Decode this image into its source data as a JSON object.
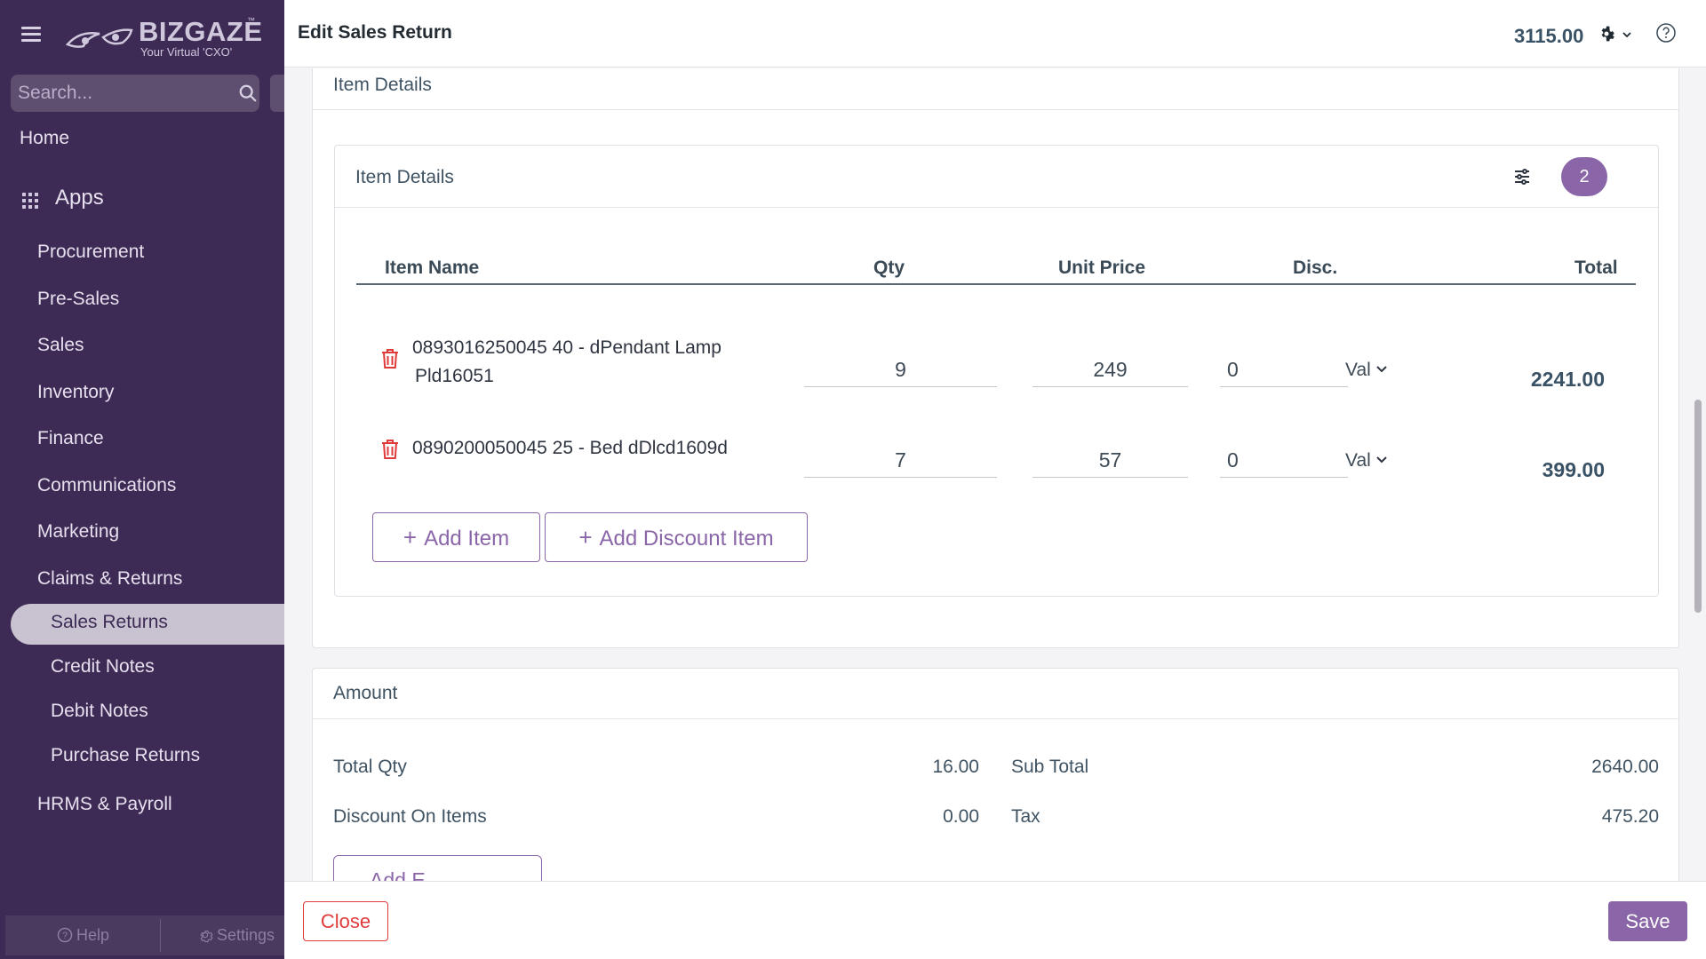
{
  "sidebar": {
    "logo": {
      "brand": "BIZGAZE",
      "tm": "™",
      "tagline": "Your Virtual 'CXO'"
    },
    "search": {
      "placeholder": "Search..."
    },
    "home": "Home",
    "apps": "Apps",
    "items": [
      "Procurement",
      "Pre-Sales",
      "Sales",
      "Inventory",
      "Finance",
      "Communications",
      "Marketing",
      "Claims & Returns"
    ],
    "subitems": [
      "Sales Returns",
      "Credit Notes",
      "Debit Notes",
      "Purchase Returns"
    ],
    "active_item": "Sales Returns",
    "last_item": "HRMS & Payroll",
    "footer": {
      "help": "Help",
      "settings": "Settings"
    }
  },
  "header": {
    "title": "Edit Sales Return",
    "total": "3115.00"
  },
  "item_details": {
    "section_title": "Item Details",
    "inner_title": "Item Details",
    "count": "2",
    "columns": {
      "name": "Item Name",
      "qty": "Qty",
      "unit_price": "Unit Price",
      "disc": "Disc.",
      "total": "Total"
    },
    "rows": [
      {
        "name_line1": "0893016250045 40 - dPendant Lamp",
        "name_line2": "Pld16051",
        "qty": "9",
        "unit_price": "249",
        "disc": "0",
        "disc_type": "Val",
        "total": "2241.00"
      },
      {
        "name_line1": "0890200050045 25 - Bed dDlcd1609d",
        "name_line2": "",
        "qty": "7",
        "unit_price": "57",
        "disc": "0",
        "disc_type": "Val",
        "total": "399.00"
      }
    ],
    "add_item": "Add Item",
    "add_discount_item": "Add Discount Item"
  },
  "amount": {
    "title": "Amount",
    "total_qty_label": "Total Qty",
    "total_qty": "16.00",
    "discount_label": "Discount On Items",
    "discount": "0.00",
    "sub_total_label": "Sub Total",
    "sub_total": "2640.00",
    "tax_label": "Tax",
    "tax": "475.20",
    "partial_button": "Add E"
  },
  "footer": {
    "close": "Close",
    "save": "Save"
  },
  "colors": {
    "sidebar": "#3d2b55",
    "accent": "#8a66a9",
    "danger": "#e03a3a",
    "active_nav": "#c9c3d1"
  }
}
